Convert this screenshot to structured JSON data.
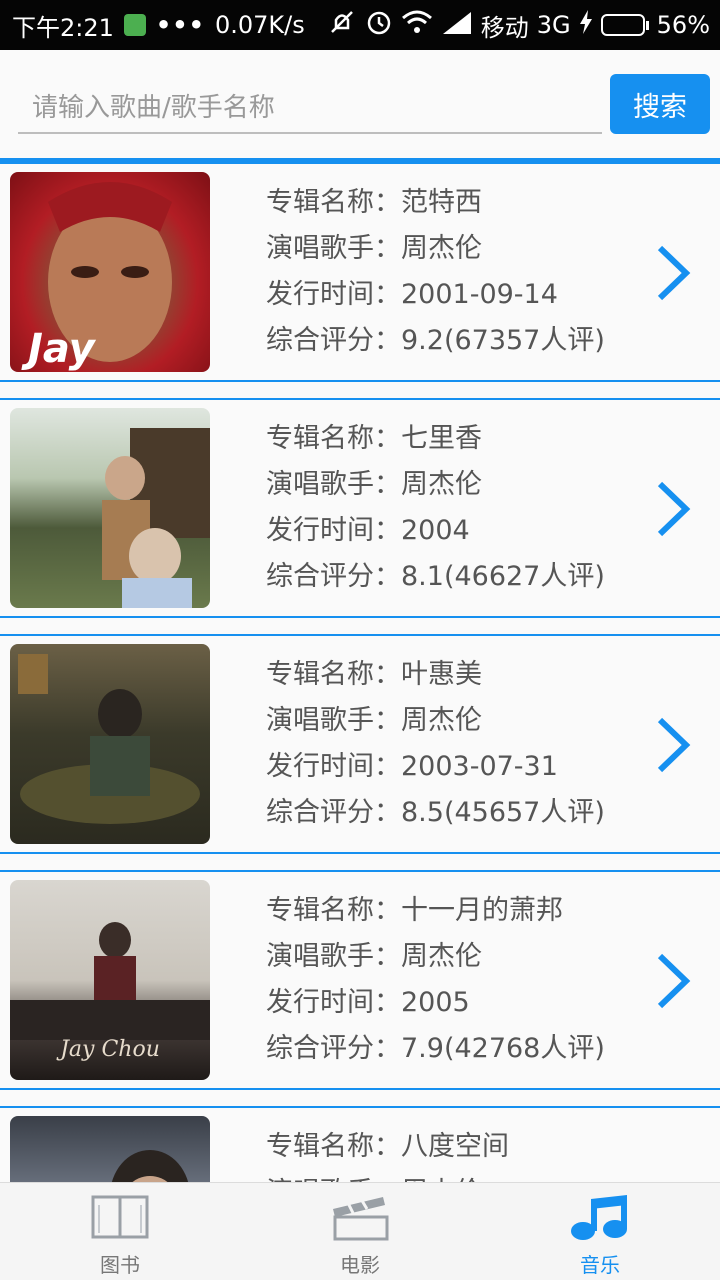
{
  "status_bar": {
    "time": "下午2:21",
    "dots": "•••",
    "speed": "0.07K/s",
    "carrier": "移动",
    "network": "3G",
    "battery": "56%",
    "battery_level": 0.56
  },
  "search": {
    "placeholder": "请输入歌曲/歌手名称",
    "value": "",
    "button_label": "搜索"
  },
  "albums": [
    {
      "name_line": "专辑名称：范特西",
      "singer_line": "演唱歌手：周杰伦",
      "date_line": "发行时间：2001-09-14",
      "rating_line": "综合评分：9.2(67357人评)"
    },
    {
      "name_line": "专辑名称：七里香",
      "singer_line": "演唱歌手：周杰伦",
      "date_line": "发行时间：2004",
      "rating_line": "综合评分：8.1(46627人评)"
    },
    {
      "name_line": "专辑名称：叶惠美",
      "singer_line": "演唱歌手：周杰伦",
      "date_line": "发行时间：2003-07-31",
      "rating_line": "综合评分：8.5(45657人评)"
    },
    {
      "name_line": "专辑名称：十一月的萧邦",
      "singer_line": "演唱歌手：周杰伦",
      "date_line": "发行时间：2005",
      "rating_line": "综合评分：7.9(42768人评)"
    },
    {
      "name_line": "专辑名称：八度空间",
      "singer_line": "演唱歌手：周杰伦",
      "date_line": "",
      "rating_line": ""
    }
  ],
  "cover_texts": {
    "cover1": "Jay",
    "cover4": "Jay Chou"
  },
  "nav": {
    "books": "图书",
    "movies": "电影",
    "music": "音乐"
  },
  "colors": {
    "accent": "#1690f0",
    "status_bar_bg": "#050505",
    "battery_fill": "#22c55e"
  },
  "icons": [
    "wechat-like-app-icon",
    "mute-icon",
    "alarm-icon",
    "wifi-icon",
    "signal-icon",
    "charging-icon",
    "battery-icon",
    "chevron-right-icon",
    "book-icon",
    "clapperboard-icon",
    "music-note-icon"
  ]
}
